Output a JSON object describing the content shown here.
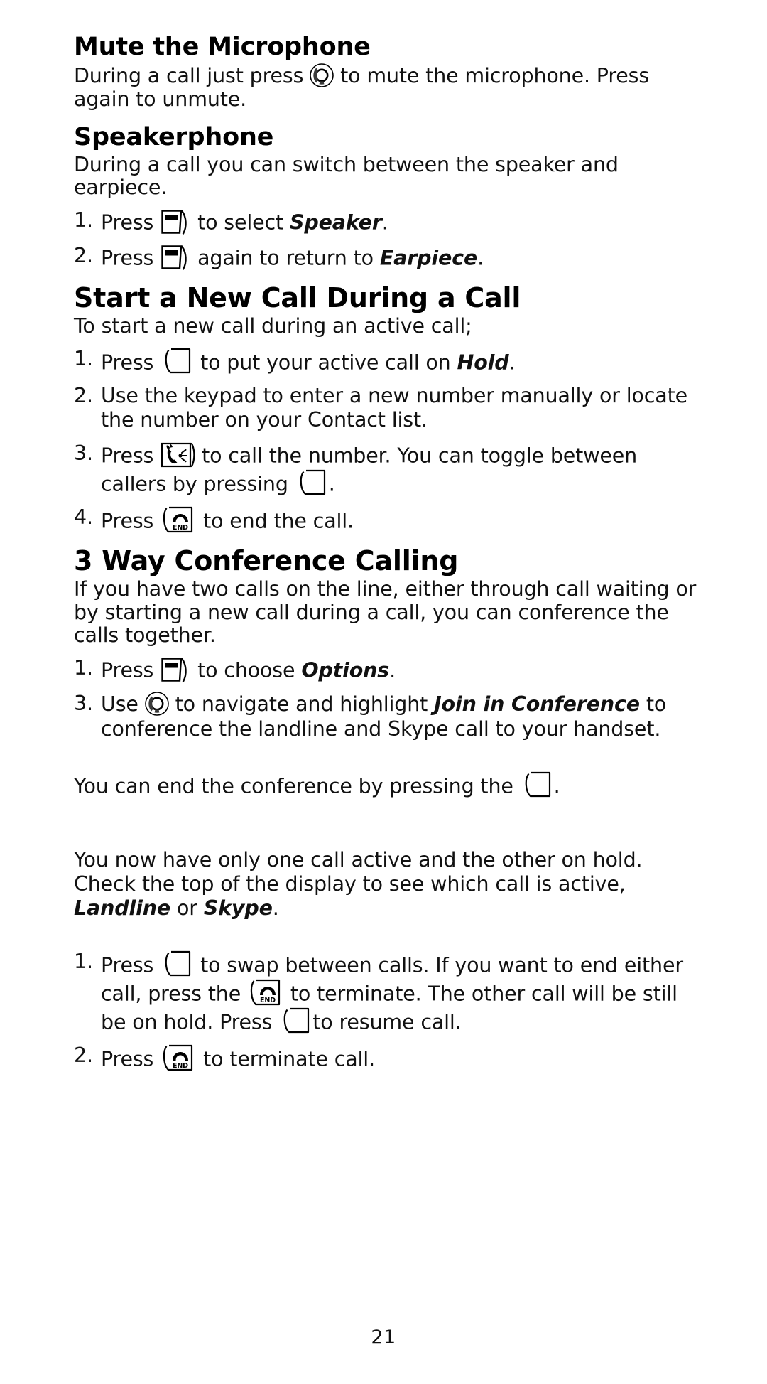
{
  "page": {
    "number": "21"
  },
  "sections": [
    {
      "id": "mute",
      "title": "Mute the Microphone",
      "intro_a": "During a call just press ",
      "intro_icon": "navigation-key-icon",
      "intro_b": " to mute the microphone. Press again to unmute."
    },
    {
      "id": "speakerphone",
      "title": "Speakerphone",
      "intro": "During a call you can switch between the speaker and earpiece.",
      "steps": [
        {
          "num": "1.",
          "before": "Press ",
          "icon": "soft-key-icon",
          "after": " to select ",
          "emphasis": "Speaker",
          "tail": "."
        },
        {
          "num": "2.",
          "before": "Press ",
          "icon": "soft-key-icon",
          "after": " again to return to ",
          "emphasis": "Earpiece",
          "tail": "."
        }
      ]
    },
    {
      "id": "new-call",
      "title": "Start a New Call During a Call",
      "intro": "To start a new call during an active call;",
      "steps": [
        {
          "num": "1.",
          "before": "Press ",
          "icon": "hold-key-icon",
          "after": " to put your active call on ",
          "emphasis": "Hold",
          "tail": "."
        },
        {
          "num": "2.",
          "before": "Use the keypad to enter a new number manually or locate the number on your Contact list.",
          "icon": "",
          "after": "",
          "emphasis": "",
          "tail": ""
        },
        {
          "num": "3.",
          "before": "Press ",
          "icon": "talk-key-icon",
          "after": " to call the number. You can toggle between callers by pressing ",
          "icon2": "hold-key-icon",
          "emphasis": "",
          "tail": "."
        },
        {
          "num": "4.",
          "before": "Press ",
          "icon": "end-key-icon",
          "after": " to end the call.",
          "emphasis": "",
          "tail": ""
        }
      ]
    },
    {
      "id": "conference",
      "title": "3 Way Conference Calling",
      "intro": "If you have two calls on the line, either through call waiting or by starting a new call during a call, you can conference the calls together.",
      "steps": [
        {
          "num": "1.",
          "before": "Press ",
          "icon": "soft-key-icon",
          "after": " to choose ",
          "emphasis": "Options",
          "tail": "."
        },
        {
          "num": "3.",
          "before": "Use ",
          "icon": "navigation-key-icon",
          "after": " to navigate and highlight ",
          "emphasis": "Join in Conference",
          "tail": " to conference the landline and Skype call to your handset."
        }
      ],
      "note_a": "You can end the conference by pressing the ",
      "note_icon": "hold-key-icon",
      "note_b": ".",
      "para_a": "You now have only one call active and the other on hold. Check the top of the display to see which call is active, ",
      "para_em1": "Landline",
      "para_mid": " or ",
      "para_em2": "Skype",
      "para_end": ".",
      "steps2": [
        {
          "num": "1.",
          "seg1": "Press ",
          "icon1": "hold-key-icon",
          "seg2": " to swap between calls.  If you want to end either call, press the ",
          "icon2": "end-key-icon",
          "seg3": " to terminate. The other call will be still be on hold. Press ",
          "icon3": "hold-key-icon",
          "seg4": "to resume call."
        },
        {
          "num": "2.",
          "seg1": "Press ",
          "icon1": "end-key-icon",
          "seg2": " to terminate call.",
          "icon2": "",
          "seg3": "",
          "icon3": "",
          "seg4": ""
        }
      ]
    }
  ]
}
